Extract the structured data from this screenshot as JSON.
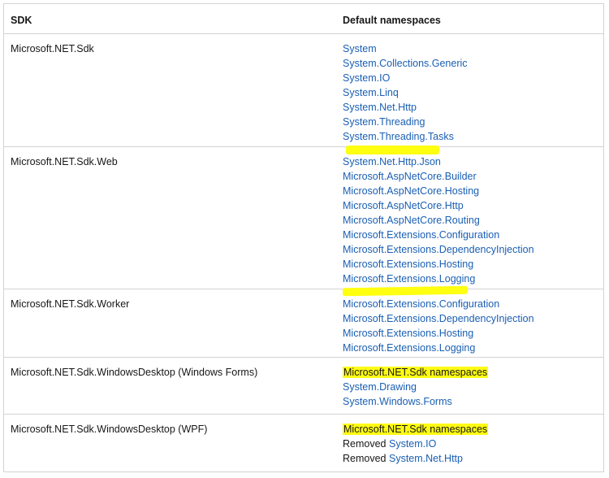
{
  "table": {
    "headers": {
      "sdk": "SDK",
      "namespaces": "Default namespaces"
    },
    "rows": [
      {
        "sdk": "Microsoft.NET.Sdk",
        "namespaces": [
          "System",
          "System.Collections.Generic",
          "System.IO",
          "System.Linq",
          "System.Net.Http",
          "System.Threading",
          "System.Threading.Tasks"
        ]
      },
      {
        "sdk": "Microsoft.NET.Sdk.Web",
        "namespaces": [
          "System.Net.Http.Json",
          "Microsoft.AspNetCore.Builder",
          "Microsoft.AspNetCore.Hosting",
          "Microsoft.AspNetCore.Http",
          "Microsoft.AspNetCore.Routing",
          "Microsoft.Extensions.Configuration",
          "Microsoft.Extensions.DependencyInjection",
          "Microsoft.Extensions.Hosting",
          "Microsoft.Extensions.Logging"
        ]
      },
      {
        "sdk": "Microsoft.NET.Sdk.Worker",
        "namespaces": [
          "Microsoft.Extensions.Configuration",
          "Microsoft.Extensions.DependencyInjection",
          "Microsoft.Extensions.Hosting",
          "Microsoft.Extensions.Logging"
        ]
      },
      {
        "sdk": "Microsoft.NET.Sdk.WindowsDesktop (Windows Forms)",
        "highlighted_line": "Microsoft.NET.Sdk namespaces",
        "namespaces": [
          "System.Drawing",
          "System.Windows.Forms"
        ]
      },
      {
        "sdk": "Microsoft.NET.Sdk.WindowsDesktop (WPF)",
        "highlighted_line": "Microsoft.NET.Sdk namespaces",
        "removed_prefix": "Removed",
        "removed": [
          "System.IO",
          "System.Net.Http"
        ]
      }
    ]
  },
  "colors": {
    "link": "#1a5fb4",
    "highlight": "#ffff10",
    "border": "#d3d3d3",
    "text": "#171717"
  }
}
